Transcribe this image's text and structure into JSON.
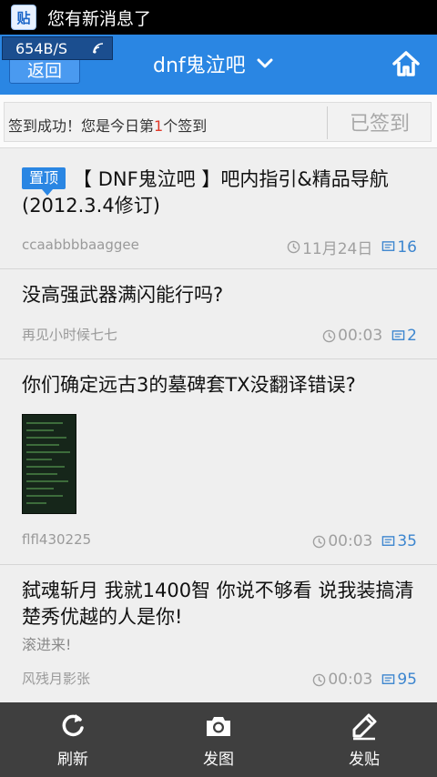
{
  "status_bar": {
    "app_icon_glyph": "贴",
    "notification_text": "您有新消息了"
  },
  "header": {
    "network_speed": "654B/S",
    "back_label": "返回",
    "forum_title": "dnf鬼泣吧",
    "accent_color": "#2a86e3"
  },
  "signin": {
    "text_prefix": "签到成功！您是今日第",
    "rank": "1",
    "text_suffix": "个签到",
    "button_label": "已签到"
  },
  "posts": [
    {
      "badge": "置顶",
      "title": "【 DNF鬼泣吧 】吧内指引&精品导航(2012.3.4修订)",
      "author": "ccaabbbbaaggee",
      "time": "11月24日",
      "replies": "16"
    },
    {
      "title": "没高强武器满闪能行吗?",
      "author": "再见小时候七七",
      "time": "00:03",
      "replies": "2"
    },
    {
      "title": "你们确定远古3的墓碑套TX没翻译错误?",
      "author": "flfl430225",
      "time": "00:03",
      "replies": "35"
    },
    {
      "title": "弑魂斩月 我就1400智 你说不够看 说我装搞清楚秀优越的人是你!",
      "excerpt": "滚进来!",
      "author": "风残月影张",
      "time": "00:03",
      "replies": "95"
    }
  ],
  "toolbar": {
    "refresh_label": "刷新",
    "photo_label": "发图",
    "post_label": "发贴"
  }
}
